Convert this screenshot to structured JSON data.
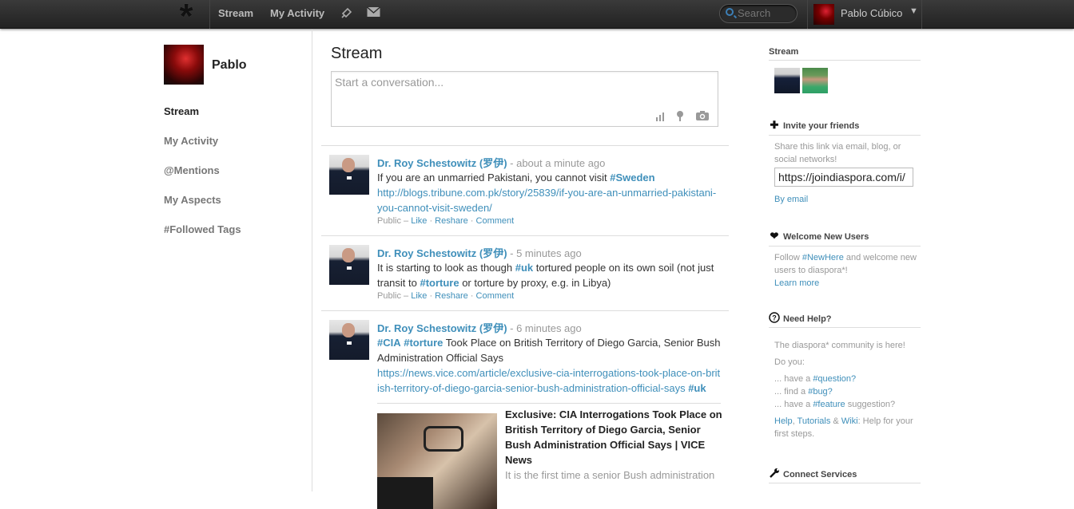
{
  "topbar": {
    "nav": [
      "Stream",
      "My Activity"
    ],
    "search_placeholder": "Search",
    "user_name": "Pablo Cúbico",
    "icons": [
      "diaspora-logo-icon",
      "notifications-icon",
      "mail-icon",
      "search-icon",
      "caret-down-icon"
    ]
  },
  "left": {
    "profile_name": "Pablo",
    "nav": [
      "Stream",
      "My Activity",
      "@Mentions",
      "My Aspects",
      "#Followed Tags"
    ]
  },
  "main": {
    "title": "Stream",
    "publisher_placeholder": "Start a conversation...",
    "posts": [
      {
        "author": "Dr. Roy Schestowitz (罗伊)",
        "time": " - about a minute ago",
        "text": "If you are an unmarried Pakistani, you cannot visit ",
        "tag": "#Sweden",
        "link": "http://blogs.tribune.com.pk/story/25839/if-you-are-an-unmarried-pakistani-you-cannot-visit-sweden/",
        "meta_prefix": "Public – ",
        "like": "Like",
        "reshare": "Reshare",
        "comment": "Comment"
      },
      {
        "author": "Dr. Roy Schestowitz (罗伊)",
        "time": " - 5 minutes ago",
        "text_1": "It is starting to look as though ",
        "tag_1": "#uk",
        "text_2": " tortured people on its own soil (not just transit to ",
        "tag_2": "#torture",
        "text_3": " or torture by proxy, e.g. in Libya)",
        "meta_prefix": "Public – ",
        "like": "Like",
        "reshare": "Reshare",
        "comment": "Comment"
      },
      {
        "author": "Dr. Roy Schestowitz (罗伊)",
        "time": " - 6 minutes ago",
        "tag_1": "#CIA",
        "tag_2": "#torture",
        "text": " Took Place on British Territory of Diego Garcia, Senior Bush Administration Official Says",
        "link": "https://news.vice.com/article/exclusive-cia-interrogations-took-place-on-british-territory-of-diego-garcia-senior-bush-administration-official-says",
        "tag_3": "#uk",
        "embed_title": "Exclusive: CIA Interrogations Took Place on British Territory of Diego Garcia, Senior Bush Administration Official Says | VICE News",
        "embed_desc": "It is the first time a senior Bush administration"
      }
    ]
  },
  "right": {
    "stream_title": "Stream",
    "invite_title": "Invite your friends",
    "invite_text": "Share this link via email, blog, or social networks!",
    "invite_url": "https://joindiaspora.com/i/",
    "by_email": "By email",
    "welcome_title": "Welcome New Users",
    "welcome_text_1": "Follow ",
    "welcome_tag": "#NewHere",
    "welcome_text_2": " and welcome new users to diaspora*!",
    "learn_more": "Learn more",
    "help_title": "Need Help?",
    "help_text": "The diaspora* community is here!",
    "do_you": "Do you:",
    "have_a": "... have a ",
    "question": "#question?",
    "find_a": "... find a ",
    "bug": "#bug?",
    "have_a_2": "... have a ",
    "feature": "#feature",
    "suggestion": " suggestion?",
    "help_link": "Help",
    "comma": ", ",
    "tutorials": "Tutorials",
    "amp": " & ",
    "wiki": "Wiki",
    "help_tail": ": Help for your first steps.",
    "connect_title": "Connect Services"
  }
}
